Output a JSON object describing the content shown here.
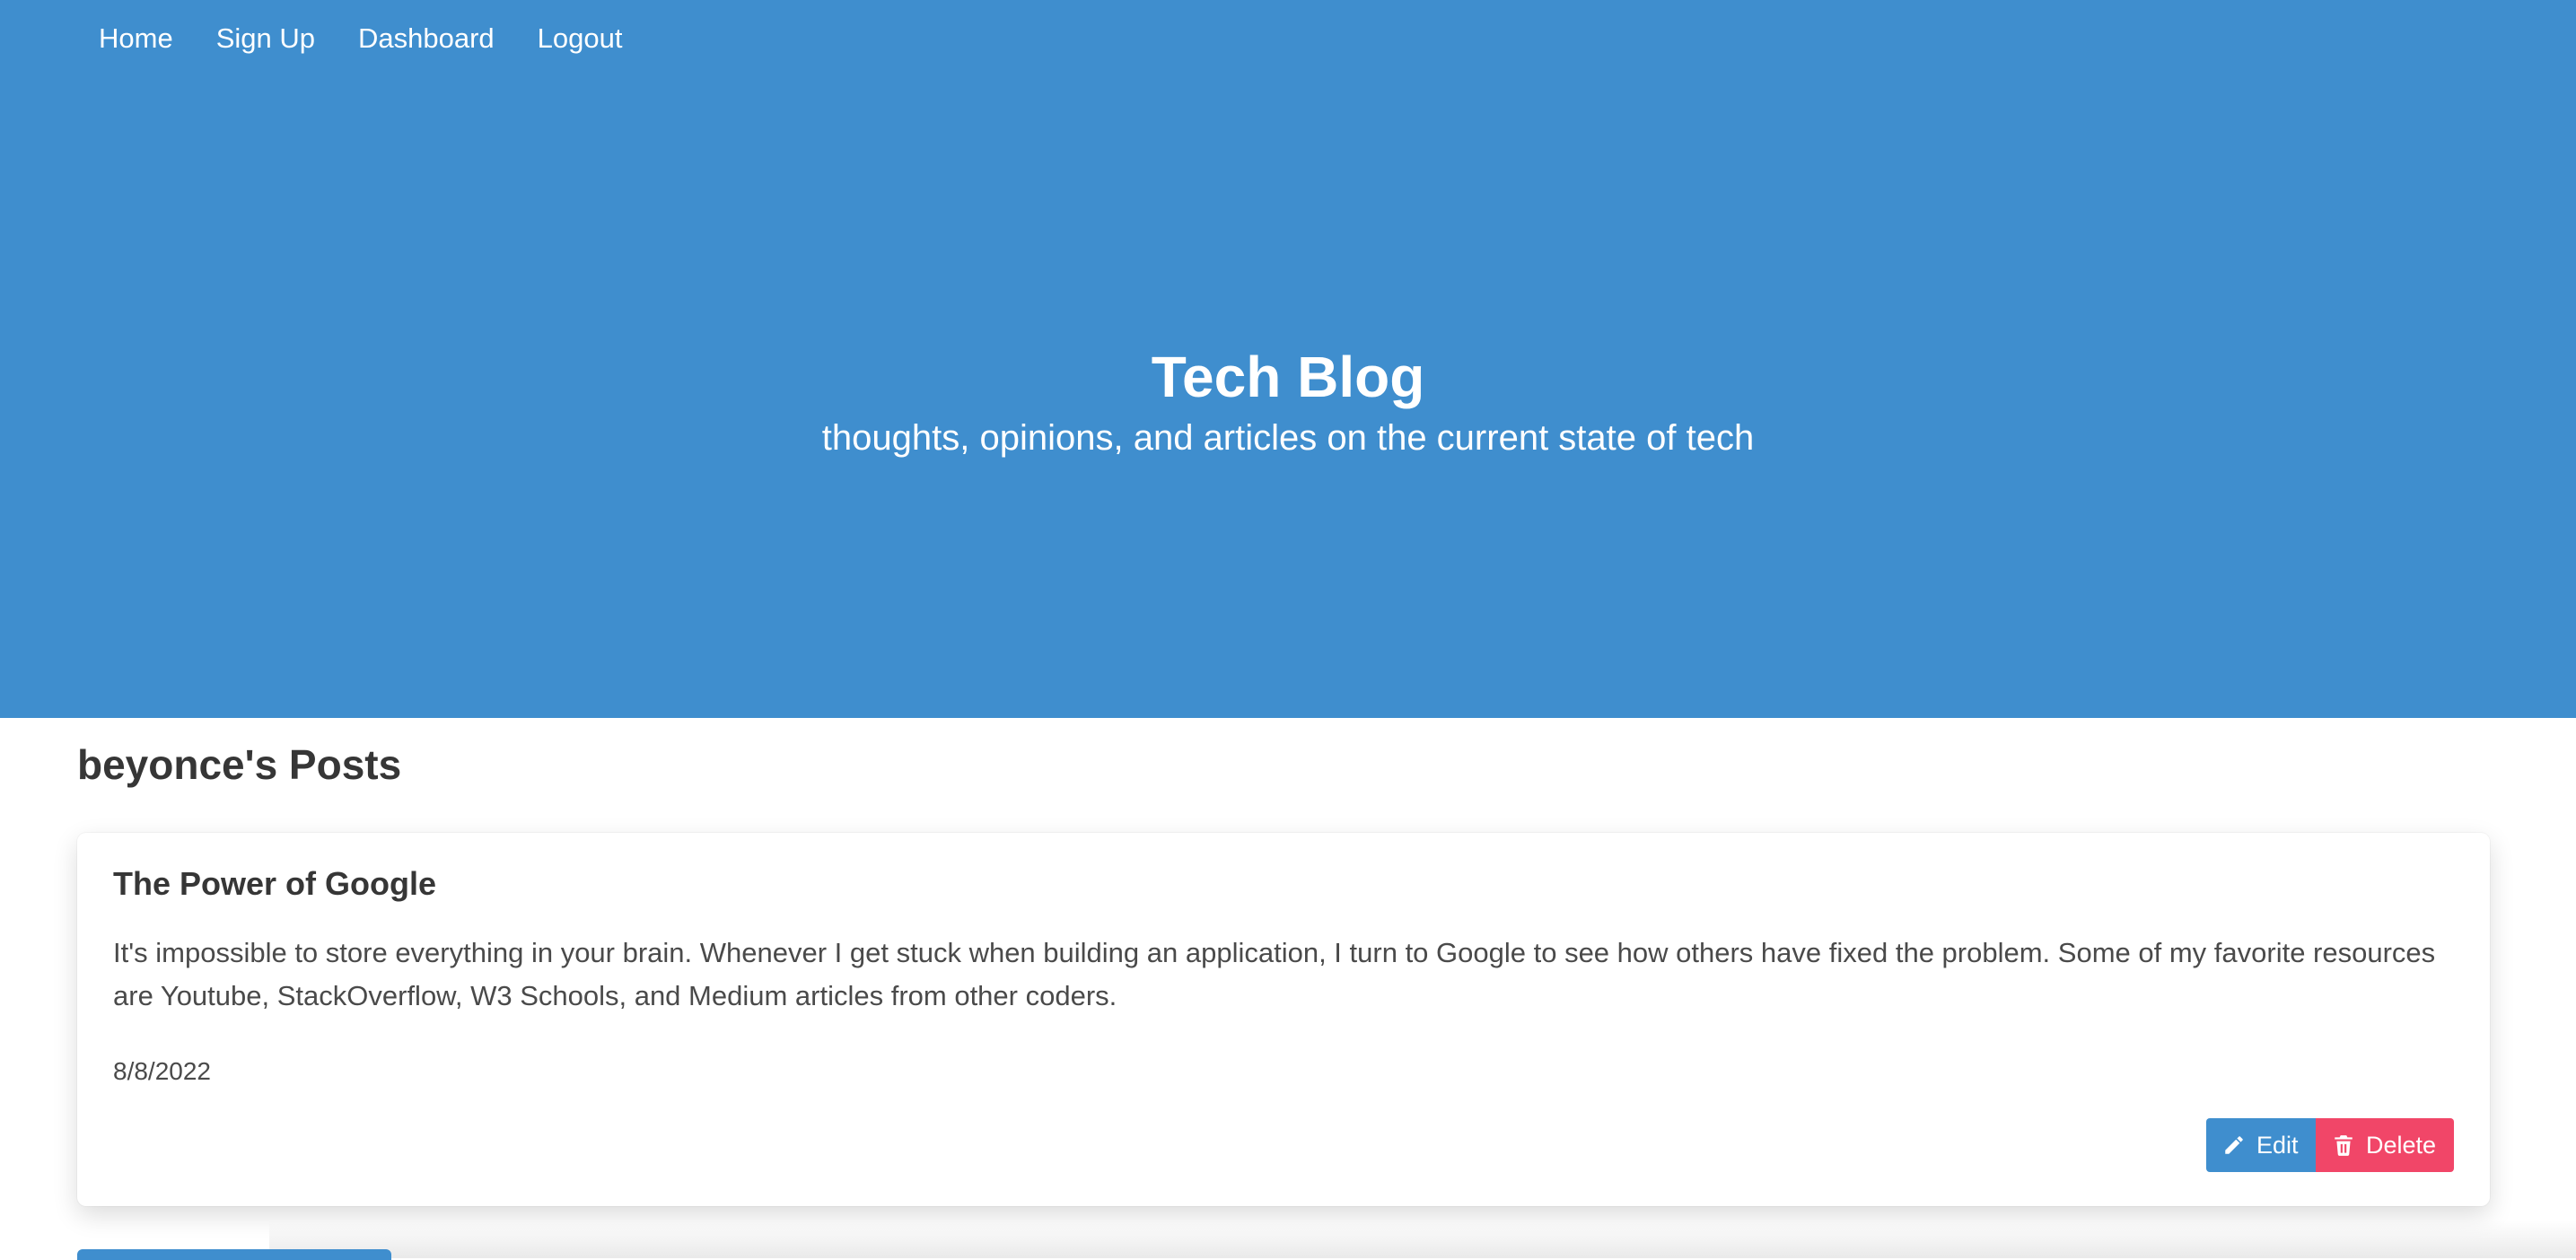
{
  "nav": {
    "items": [
      {
        "label": "Home"
      },
      {
        "label": "Sign Up"
      },
      {
        "label": "Dashboard"
      },
      {
        "label": "Logout"
      }
    ]
  },
  "hero": {
    "title": "Tech Blog",
    "subtitle": "thoughts, opinions, and articles on the current state of tech",
    "background_color": "#3f8ece"
  },
  "posts": {
    "heading": "beyonce's Posts",
    "items": [
      {
        "title": "The Power of Google",
        "body": "It's impossible to store everything in your brain. Whenever I get stuck when building an application, I turn to Google to see how others have fixed the problem. Some of my favorite resources are Youtube, StackOverflow, W3 Schools, and Medium articles from other coders.",
        "date": "8/8/2022",
        "edit_label": "Edit",
        "delete_label": "Delete",
        "edit_icon": "pencil-icon",
        "delete_icon": "trash-icon"
      }
    ]
  },
  "colors": {
    "primary": "#3f8ece",
    "danger": "#f14668",
    "text": "#363636"
  }
}
